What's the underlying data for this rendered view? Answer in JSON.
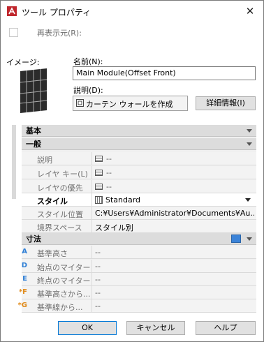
{
  "window": {
    "title": "ツール プロパティ",
    "close_symbol": "✕"
  },
  "restore": {
    "label": "再表示元(R):",
    "checked": false
  },
  "image": {
    "label": "イメージ:"
  },
  "name": {
    "label": "名前(N):",
    "value": "Main Module(Offset Front)"
  },
  "description": {
    "label": "説明(D):",
    "value": "カーテン ウォールを作成",
    "details_button": "詳細情報(I)"
  },
  "sections": {
    "basic": "基本",
    "general": "一般",
    "dimensions": "寸法"
  },
  "general_rows": [
    {
      "label": "説明",
      "value": "--",
      "icon": "list-icon"
    },
    {
      "label": "レイヤ キー(L)",
      "value": "--",
      "icon": "list-icon"
    },
    {
      "label": "レイヤの優先",
      "value": "--",
      "icon": "list-icon"
    },
    {
      "label": "スタイル",
      "value": "Standard",
      "icon": "style-icon"
    },
    {
      "label": "スタイル位置",
      "value": "C:¥Users¥Administrator¥Documents¥Au..."
    },
    {
      "label": "境界スペース",
      "value": "スタイル別"
    }
  ],
  "dimension_rows": [
    {
      "marker": "A",
      "label": "基準高さ",
      "value": "--"
    },
    {
      "marker": "D",
      "label": "始点のマイター",
      "value": "--"
    },
    {
      "marker": "E",
      "label": "終点のマイター",
      "value": "--"
    },
    {
      "marker": "*F",
      "label": "基準高さから...",
      "value": "--"
    },
    {
      "marker": "*G",
      "label": "基準線から...",
      "value": "--"
    }
  ],
  "footer": {
    "ok": "OK",
    "cancel": "キャンセル",
    "help": "ヘルプ"
  },
  "colors": {
    "accent": "#0078d7",
    "marker_blue": "#2f7fd6",
    "marker_orange": "#e08a1a"
  }
}
